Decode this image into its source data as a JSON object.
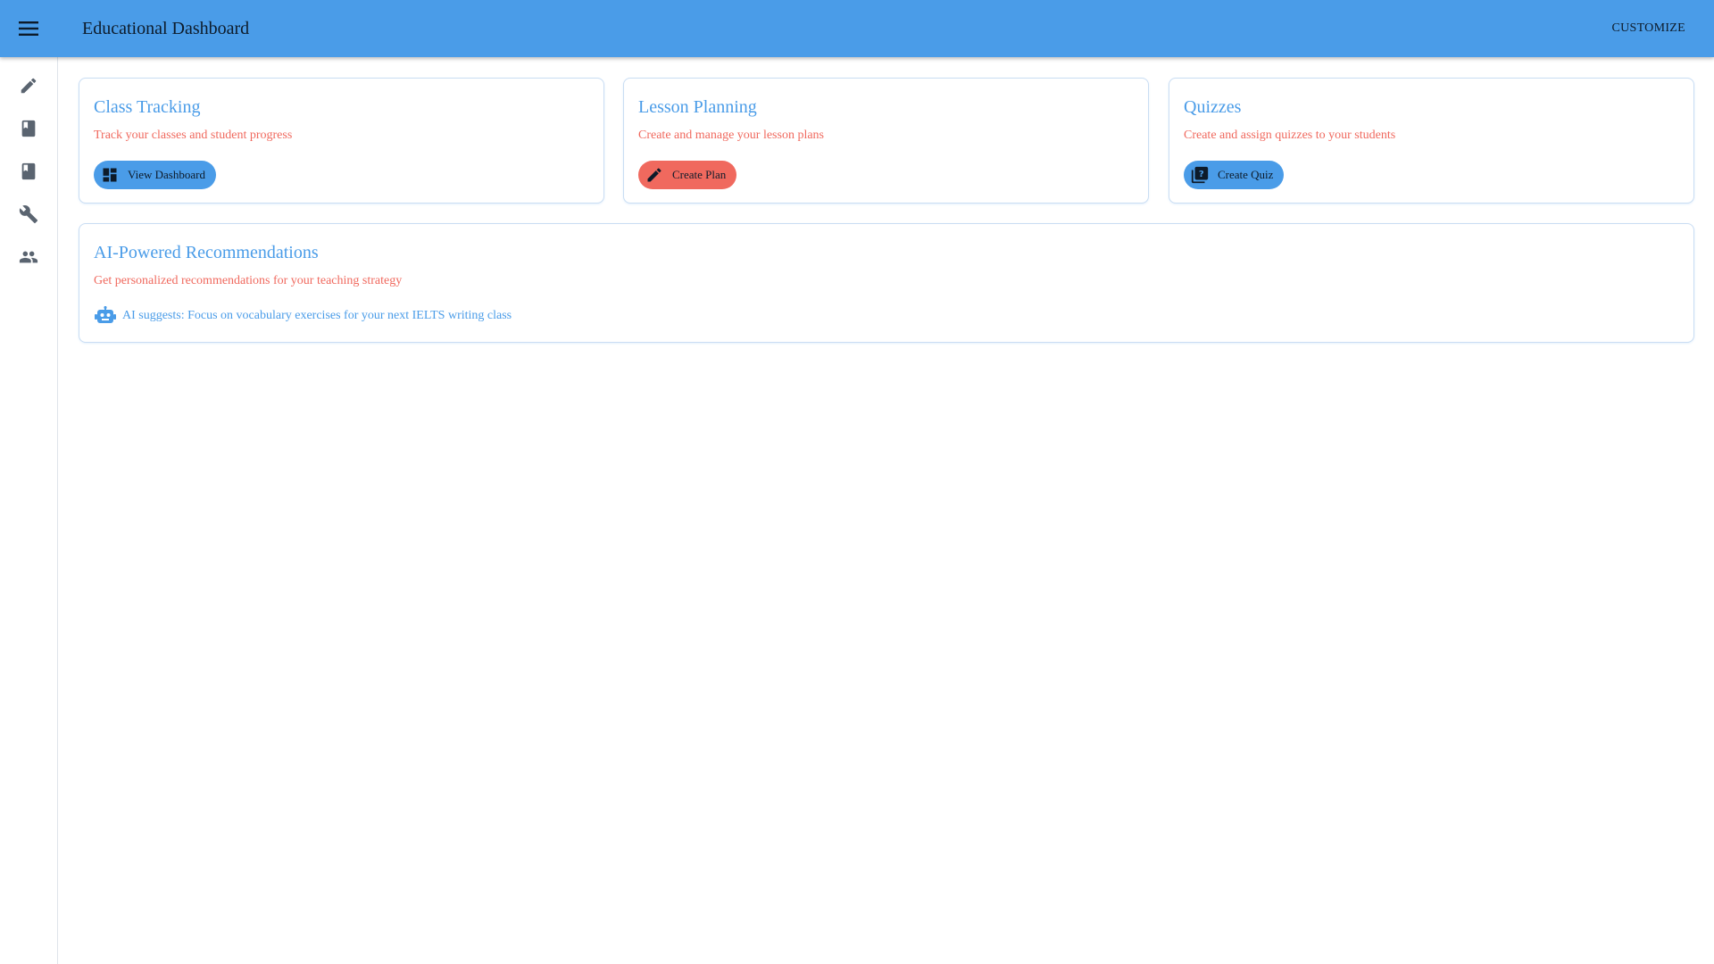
{
  "app": {
    "title": "Educational Dashboard",
    "customize_label": "CUSTOMIZE",
    "menu_icon": "menu-icon"
  },
  "colors": {
    "primary": "#4a9ce8",
    "accent": "#f0695e",
    "text_dark": "#0d1b2a"
  },
  "sidebar": {
    "items": [
      {
        "icon": "pencil-icon"
      },
      {
        "icon": "book-icon"
      },
      {
        "icon": "book-icon"
      },
      {
        "icon": "wrench-icon"
      },
      {
        "icon": "people-icon"
      }
    ]
  },
  "cards": {
    "class_tracking": {
      "title": "Class Tracking",
      "subtitle": "Track your classes and student progress",
      "button_label": "View Dashboard",
      "button_icon": "dashboard-icon"
    },
    "lesson_planning": {
      "title": "Lesson Planning",
      "subtitle": "Create and manage your lesson plans",
      "button_label": "Create Plan",
      "button_icon": "pencil-icon"
    },
    "quizzes": {
      "title": "Quizzes",
      "subtitle": "Create and assign quizzes to your students",
      "button_label": "Create Quiz",
      "button_icon": "quiz-icon"
    },
    "ai": {
      "title": "AI-Powered Recommendations",
      "subtitle": "Get personalized recommendations for your teaching strategy",
      "suggestion": "AI suggests: Focus on vocabulary exercises for your next IELTS writing class",
      "suggestion_icon": "robot-icon"
    }
  }
}
